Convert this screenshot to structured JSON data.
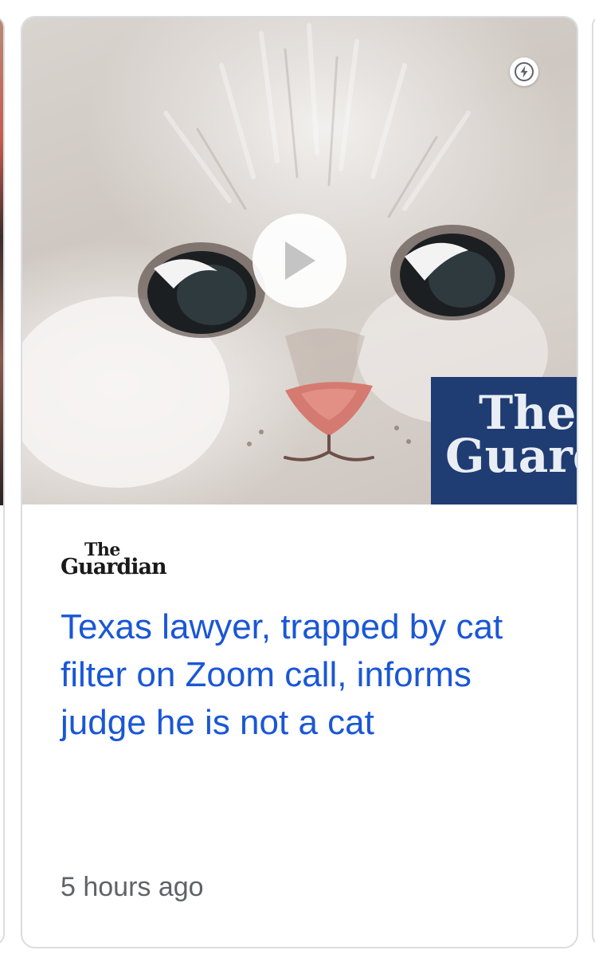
{
  "card": {
    "media": {
      "icon": "play-icon",
      "badge_icon": "amp-lightning-icon",
      "watermark_line1": "The",
      "watermark_line2": "Guardian"
    },
    "publisher": {
      "name_line1": "The",
      "name_line2": "Guardian"
    },
    "headline": "Texas lawyer, trapped by cat filter on Zoom call, informs judge he is not a cat",
    "timestamp": "5 hours ago"
  },
  "colors": {
    "headline_link": "#1a57d6",
    "timestamp": "#5f6368",
    "card_border": "#dadce0",
    "watermark_bg": "#1f3c73"
  }
}
